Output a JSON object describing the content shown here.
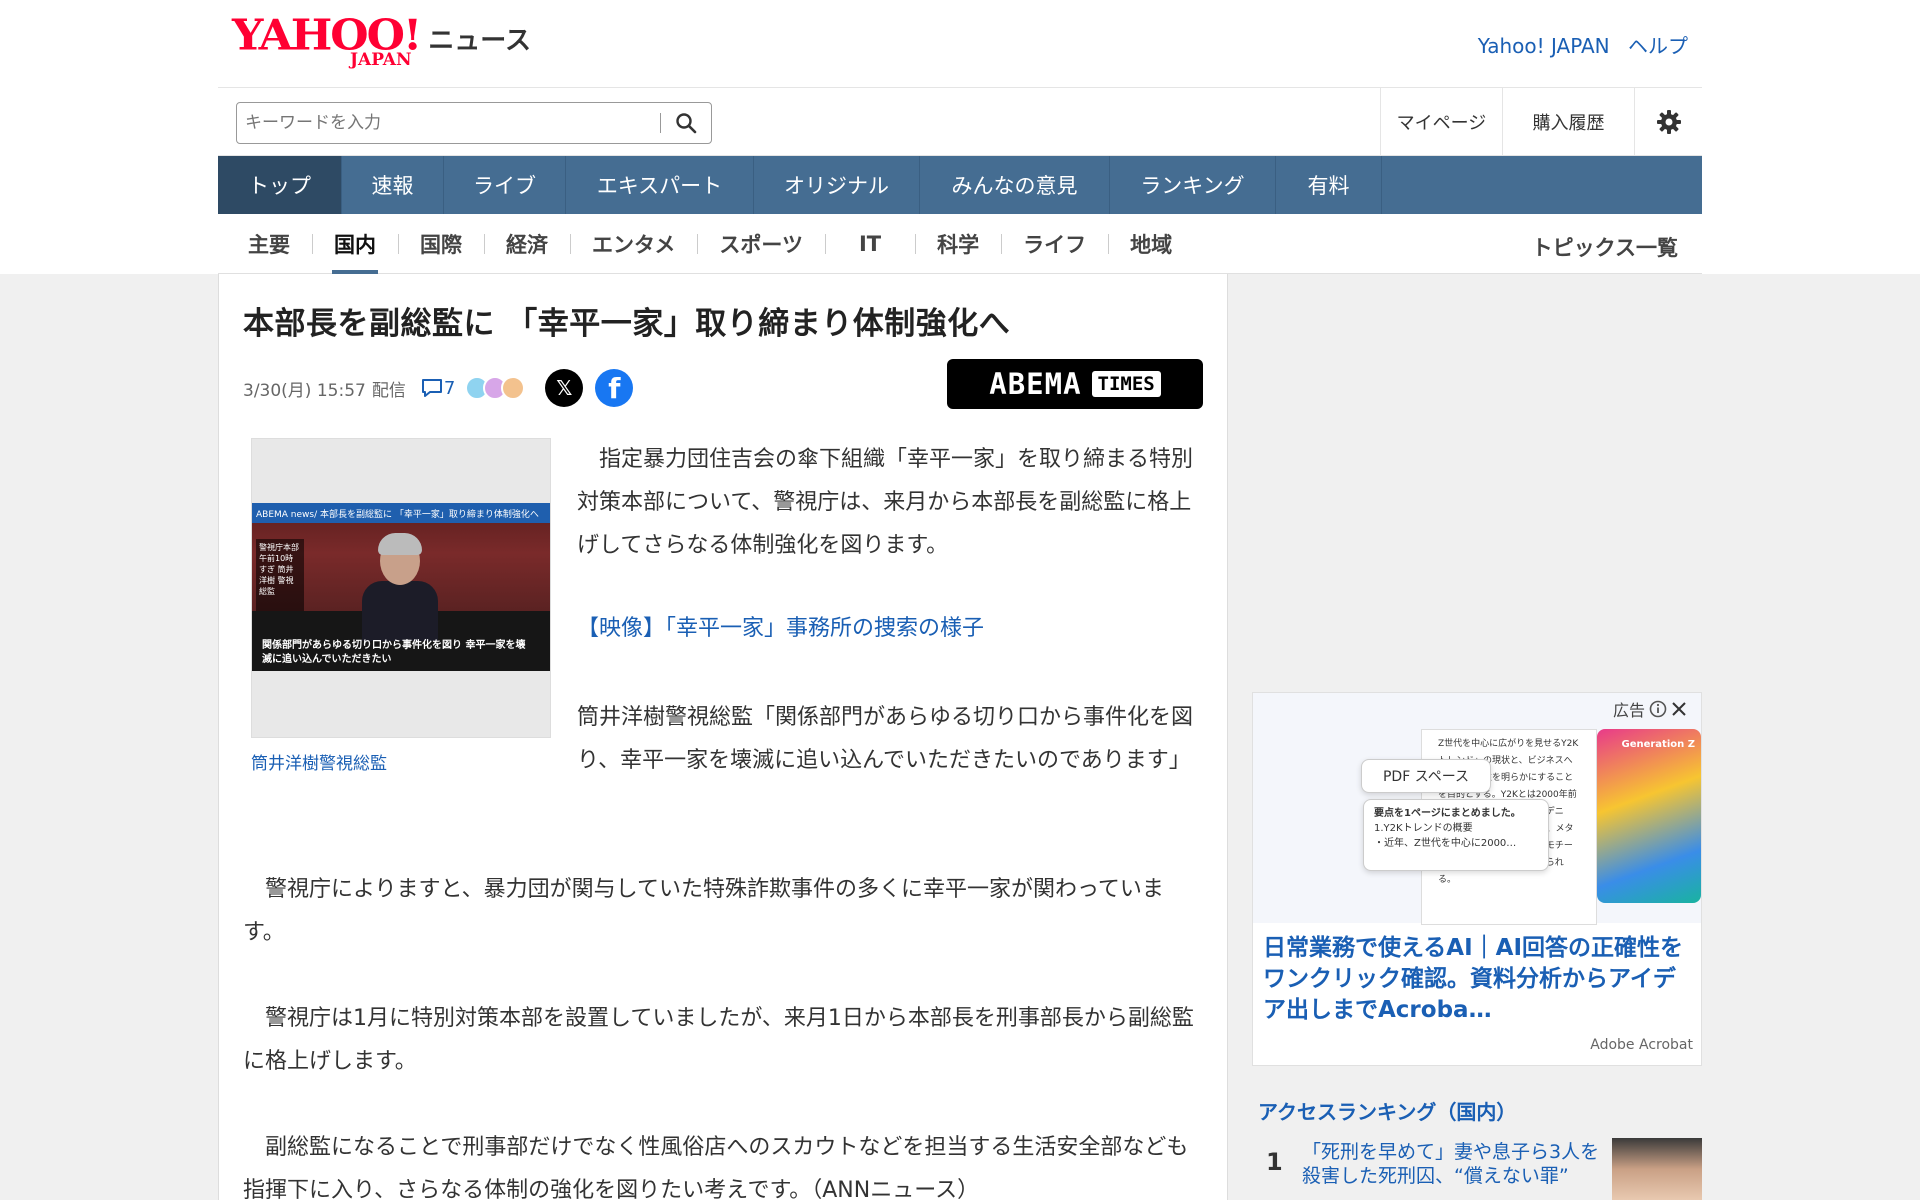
{
  "header": {
    "logo_main": "YAHOO!",
    "logo_sub": "JAPAN",
    "logo_service": "ニュース",
    "link_yahoo_japan": "Yahoo! JAPAN",
    "link_help": "ヘルプ"
  },
  "search": {
    "placeholder": "キーワードを入力",
    "icon": "search-icon"
  },
  "user_links": {
    "mypage": "マイページ",
    "purchase_history": "購入履歴",
    "settings_icon": "gear-icon"
  },
  "nav": {
    "items": [
      {
        "label": "トップ",
        "active": true
      },
      {
        "label": "速報"
      },
      {
        "label": "ライブ"
      },
      {
        "label": "エキスパート"
      },
      {
        "label": "オリジナル"
      },
      {
        "label": "みんなの意見"
      },
      {
        "label": "ランキング"
      },
      {
        "label": "有料"
      }
    ]
  },
  "subnav": {
    "items": [
      {
        "label": "主要"
      },
      {
        "label": "国内",
        "active": true
      },
      {
        "label": "国際"
      },
      {
        "label": "経済"
      },
      {
        "label": "エンタメ"
      },
      {
        "label": "スポーツ"
      },
      {
        "label": "IT"
      },
      {
        "label": "科学"
      },
      {
        "label": "ライフ"
      },
      {
        "label": "地域"
      }
    ],
    "topics_link": "トピックス一覧"
  },
  "article": {
    "title": "本部長を副総監に 「幸平一家」取り締まり体制強化へ",
    "date": "3/30(月) 15:57",
    "delivery": "配信",
    "comment_count": "7",
    "source_logo_word": "ABEMA",
    "source_logo_badge": "TIMES",
    "share_x": "𝕏",
    "share_facebook": "f",
    "photo_strip": "ABEMA news/ 本部長を副総監に 「幸平一家」取り締まり体制強化へ",
    "photo_side": "警視庁本部 午前10時すぎ 筒井洋樹 警視総監",
    "photo_caption_on_image": "関係部門があらゆる切り口から事件化を図り 幸平一家を壊滅に追い込んでいただきたい",
    "photo_caption": "筒井洋樹警視総監",
    "lead": "指定暴力団住吉会の傘下組織「幸平一家」を取り締まる特別対策本部について、警視庁は、来月から本部長を副総監に格上げしてさらなる体制強化を図ります。",
    "video_link": "【映像】「幸平一家」事務所の捜索の様子",
    "quote": "筒井洋樹警視総監「関係部門があらゆる切り口から事件化を図り、幸平一家を壊滅に追い込んでいただきたいのであります」",
    "paragraph_1": "警視庁によりますと、暴力団が関与していた特殊詐欺事件の多くに幸平一家が関わっています。",
    "paragraph_2": "警視庁は1月に特別対策本部を設置していましたが、来月1日から本部長を刑事部長から副総監に格上げします。",
    "paragraph_3": "副総監になることで刑事部だけでなく性風俗店へのスカウトなどを担当する生活安全部なども指揮下に入り、さらなる体制の強化を図りたい考えです。（ANNニュース）"
  },
  "ad": {
    "label": "広告",
    "pill": "PDF スペース",
    "doc_text": "Z世代を中心に広がりを見せるY2Kトレンド」の現状と、ビジネスへの活用可能性を明らかにすることを目的とする。Y2Kとは2000年前後のファッション…ライズデニム、スパンコールトップス、メタリックカラー、バタフライモチーフなどが代表例として挙げられる。",
    "summary_title": "要点を1ページにまとめました。",
    "summary_line1": "1.Y2Kトレンドの概要",
    "summary_line2": "・近年、Z世代を中心に2000…",
    "cover_text": "Generation Z",
    "title": "日常業務で使えるAI｜AI回答の正確性をワンクリック確認。資料分析からアイデア出しまでAcroba…",
    "sponsor": "Adobe Acrobat"
  },
  "ranking": {
    "title": "アクセスランキング（国内）",
    "items": [
      {
        "rank": "1",
        "text": "「死刑を早めて」妻や息子ら3人を殺害した死刑囚、“償えない罪”"
      }
    ]
  },
  "colors": {
    "nav_bg": "#456d92",
    "link": "#1a5fb4",
    "logo_red": "#ff0033"
  }
}
